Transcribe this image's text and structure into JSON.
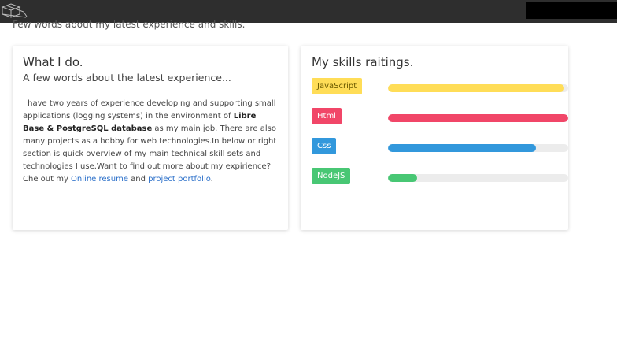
{
  "intro": "Few words about my latest experience and skills.",
  "about": {
    "title": "What I do.",
    "subtitle": "A few words about the latest experience...",
    "text_1": "I have two years of experience developing and supporting small applications (logging systems) in the environment of ",
    "bold": "Libre Base & PostgreSQL database",
    "text_2": " as my main job. There are also many projects as a hobby for web technologies.In below or right section is quick overview of my main technical skill sets and technologies I use.Want to find out more about my expirience? Che out my ",
    "link_resume": "Online resume",
    "text_3": " and ",
    "link_portfolio": "project portfolio",
    "text_4": "."
  },
  "skills": {
    "title": "My skills raitings.",
    "items": [
      {
        "label": "JavaScript",
        "level": 0.98,
        "color": "#ffdd57",
        "text_color": "#6b5a00"
      },
      {
        "label": "Html",
        "level": 1.0,
        "color": "#f14668",
        "text_color": "#ffffff"
      },
      {
        "label": "Css",
        "level": 0.82,
        "color": "#3298dc",
        "text_color": "#ffffff"
      },
      {
        "label": "NodeJS",
        "level": 0.16,
        "color": "#48c774",
        "text_color": "#ffffff"
      }
    ]
  },
  "icons": {
    "logo": "wireframe-cube-icon"
  }
}
